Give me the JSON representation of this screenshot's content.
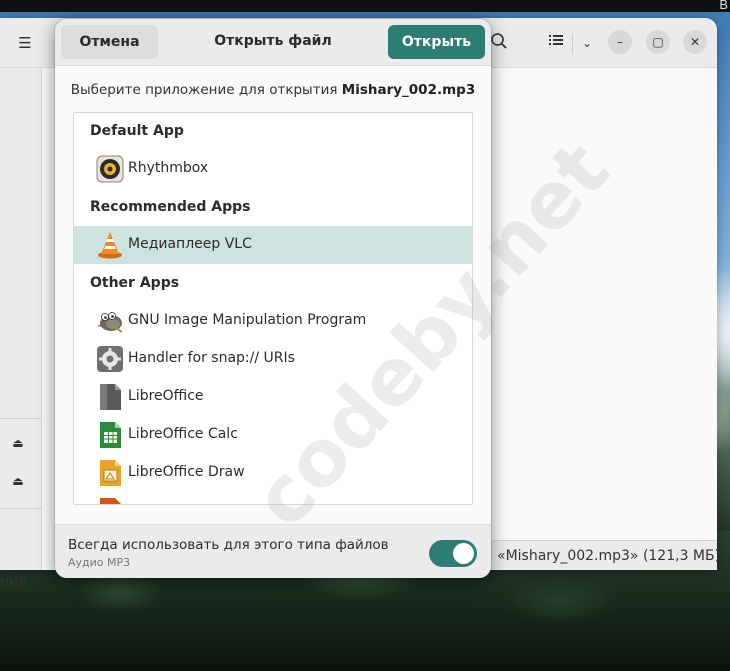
{
  "topbar": {
    "corner_text": "В"
  },
  "file_manager": {
    "menu_icon": "hamburger-icon",
    "search_icon": "search-icon",
    "view_icon": "list-view-icon",
    "chevron_icon": "chevron-down-icon",
    "minimize_icon": "minimize-icon",
    "maximize_icon": "maximize-icon",
    "close_icon": "close-icon",
    "sidebar_label": "ния",
    "status_text": "«Mishary_002.mp3»  (121,3 МБ)"
  },
  "dialog": {
    "cancel_label": "Отмена",
    "title": "Открыть файл",
    "open_label": "Открыть",
    "prompt_text": "Выберите приложение для открытия ",
    "prompt_filename": "Mishary_002.mp3",
    "sections": {
      "default": "Default App",
      "recommended": "Recommended Apps",
      "other": "Other Apps"
    },
    "apps": {
      "rhythmbox": "Rhythmbox",
      "vlc": "Медиаплеер VLC",
      "gimp": "GNU Image Manipulation Program",
      "snap": "Handler for snap:// URIs",
      "libreoffice": "LibreOffice",
      "calc": "LibreOffice Calc",
      "draw": "LibreOffice Draw"
    },
    "footer_label": "Всегда использовать для этого типа файлов",
    "footer_sub": "Аудио MP3",
    "toggle_on": true
  },
  "watermark": "codeby.net",
  "colors": {
    "accent": "#2d7d74",
    "selected_row": "#cde3e0"
  }
}
